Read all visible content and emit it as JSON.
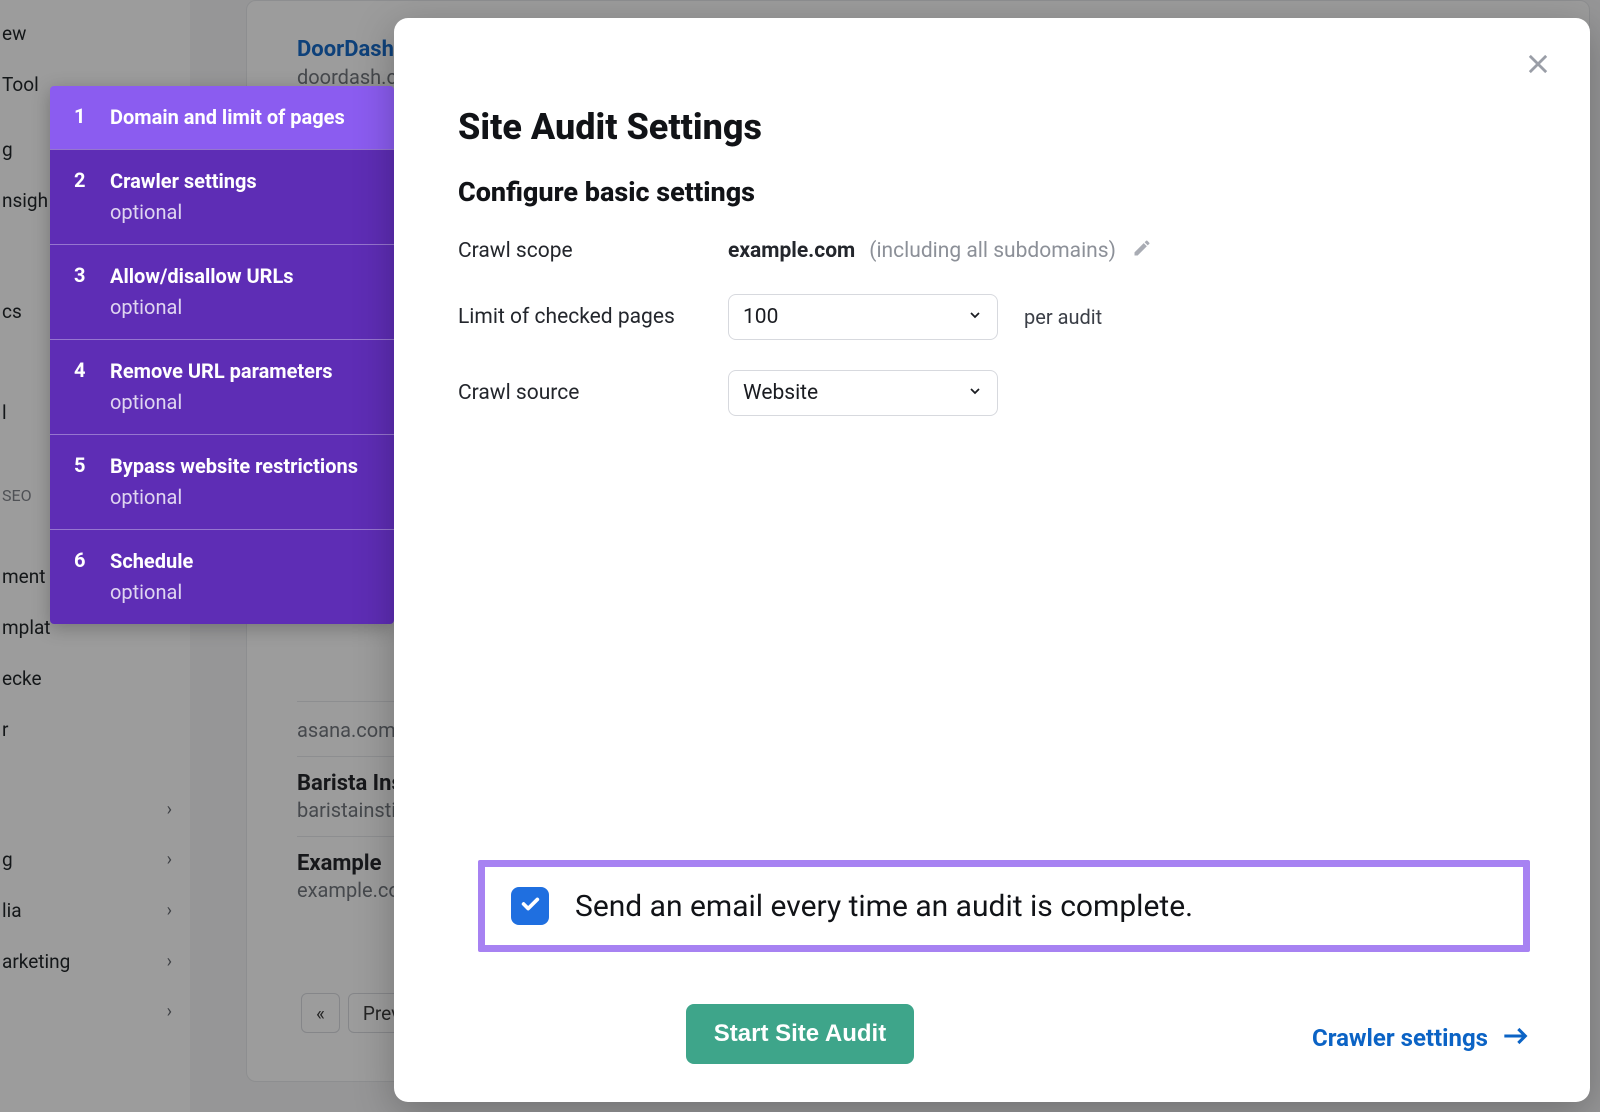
{
  "bg": {
    "sidebar_items": [
      "ew",
      "Tool",
      "",
      "g",
      "nsigh",
      "cs",
      "l",
      "SEO",
      "ment",
      "mplat",
      "ecke",
      "r"
    ],
    "sidebar_expandable": [
      "",
      "g",
      "lia",
      "arketing",
      ""
    ],
    "top_link": "DoorDash",
    "top_dom": "doordash.c",
    "list": [
      {
        "title": "",
        "dom": "asana.com"
      },
      {
        "title": "Barista Ins",
        "dom": "baristainstit"
      },
      {
        "title": "Example",
        "dom": "example.co"
      }
    ],
    "pager_prev_icon": "«",
    "pager_prev": "Prev"
  },
  "wizard": {
    "steps": [
      {
        "num": "1",
        "title": "Domain and limit of pages",
        "optional": ""
      },
      {
        "num": "2",
        "title": "Crawler settings",
        "optional": "optional"
      },
      {
        "num": "3",
        "title": "Allow/disallow URLs",
        "optional": "optional"
      },
      {
        "num": "4",
        "title": "Remove URL parameters",
        "optional": "optional"
      },
      {
        "num": "5",
        "title": "Bypass website restrictions",
        "optional": "optional"
      },
      {
        "num": "6",
        "title": "Schedule",
        "optional": "optional"
      }
    ]
  },
  "modal": {
    "title": "Site Audit Settings",
    "subtitle": "Configure basic settings",
    "rows": {
      "scope_label": "Crawl scope",
      "scope_value": "example.com",
      "scope_note": "(including all subdomains)",
      "limit_label": "Limit of checked pages",
      "limit_value": "100",
      "limit_suffix": "per audit",
      "source_label": "Crawl source",
      "source_value": "Website"
    },
    "email_label": "Send an email every time an audit is complete.",
    "start_button": "Start Site Audit",
    "next_link": "Crawler settings"
  }
}
